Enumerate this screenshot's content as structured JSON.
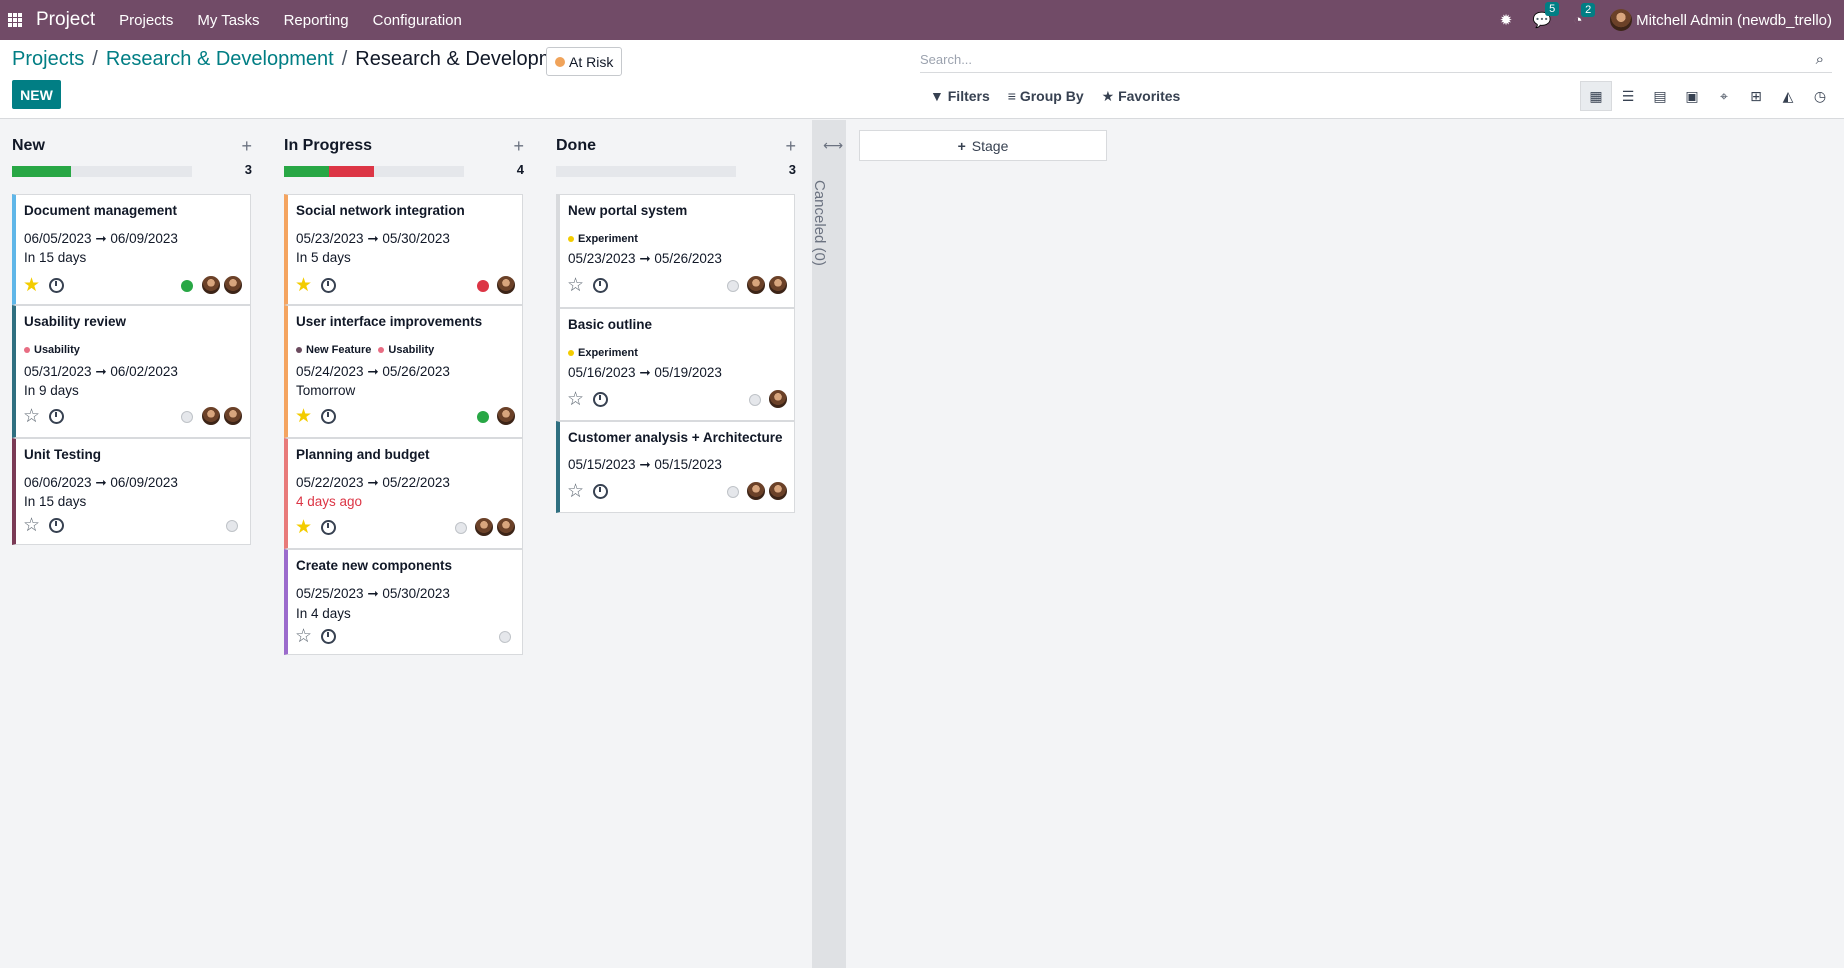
{
  "topbar": {
    "app": "Project",
    "menu": [
      "Projects",
      "My Tasks",
      "Reporting",
      "Configuration"
    ],
    "messages_count": "5",
    "activities_count": "2",
    "user": "Mitchell Admin (newdb_trello)"
  },
  "breadcrumb": {
    "root": "Projects",
    "parent": "Research & Development",
    "current": "Research & Development"
  },
  "status_label": "At Risk",
  "new_button": "NEW",
  "search": {
    "placeholder": "Search..."
  },
  "filters": {
    "filters": "Filters",
    "group_by": "Group By",
    "favorites": "Favorites"
  },
  "columns": [
    {
      "title": "New",
      "count": "3",
      "progress": {
        "green": 0.33,
        "red": 0,
        "grey": 0.67
      }
    },
    {
      "title": "In Progress",
      "count": "4",
      "progress": {
        "green": 0.25,
        "red": 0.25,
        "grey": 0.5
      }
    },
    {
      "title": "Done",
      "count": "3",
      "progress": {
        "green": 0,
        "red": 0,
        "grey": 1
      }
    }
  ],
  "cards": [
    {
      "title": "Document management",
      "dates": "06/05/2023 ➞ 06/09/2023",
      "deadline": "In 15 days",
      "starred": true,
      "state": "green",
      "avatars": 2
    },
    {
      "title": "Usability review",
      "tag": "Usability",
      "dates": "05/31/2023 ➞ 06/02/2023",
      "deadline": "In 9 days",
      "starred": false,
      "state": "normal",
      "avatars": 2
    },
    {
      "title": "Unit Testing",
      "dates": "06/06/2023 ➞ 06/09/2023",
      "deadline": "In 15 days",
      "starred": false,
      "state": "normal",
      "avatars": 0
    },
    {
      "title": "Social network integration",
      "dates": "05/23/2023 ➞ 05/30/2023",
      "deadline": "In 5 days",
      "starred": true,
      "state": "red",
      "avatars": 1
    },
    {
      "title": "User interface improvements",
      "tags": [
        "New Feature",
        "Usability"
      ],
      "dates": "05/24/2023 ➞ 05/26/2023",
      "deadline": "Tomorrow",
      "starred": true,
      "state": "green",
      "avatars": 1
    },
    {
      "title": "Planning and budget",
      "dates": "05/22/2023 ➞ 05/22/2023",
      "deadline": "4 days ago",
      "starred": true,
      "state": "normal",
      "avatars": 2
    },
    {
      "title": "Create new components",
      "dates": "05/25/2023 ➞ 05/30/2023",
      "deadline": "In 4 days",
      "starred": false,
      "state": "normal",
      "avatars": 0
    },
    {
      "title": "New portal system",
      "tag": "Experiment",
      "dates": "05/23/2023 ➞ 05/26/2023",
      "starred": false,
      "state": "normal",
      "avatars": 2
    },
    {
      "title": "Basic outline",
      "tag": "Experiment",
      "dates": "05/16/2023 ➞ 05/19/2023",
      "starred": false,
      "state": "normal",
      "avatars": 1
    },
    {
      "title": "Customer analysis + Architecture",
      "dates": "05/15/2023 ➞ 05/15/2023",
      "starred": false,
      "state": "normal",
      "avatars": 2
    }
  ],
  "folded_column": "Canceled (0)",
  "add_stage": "Stage"
}
